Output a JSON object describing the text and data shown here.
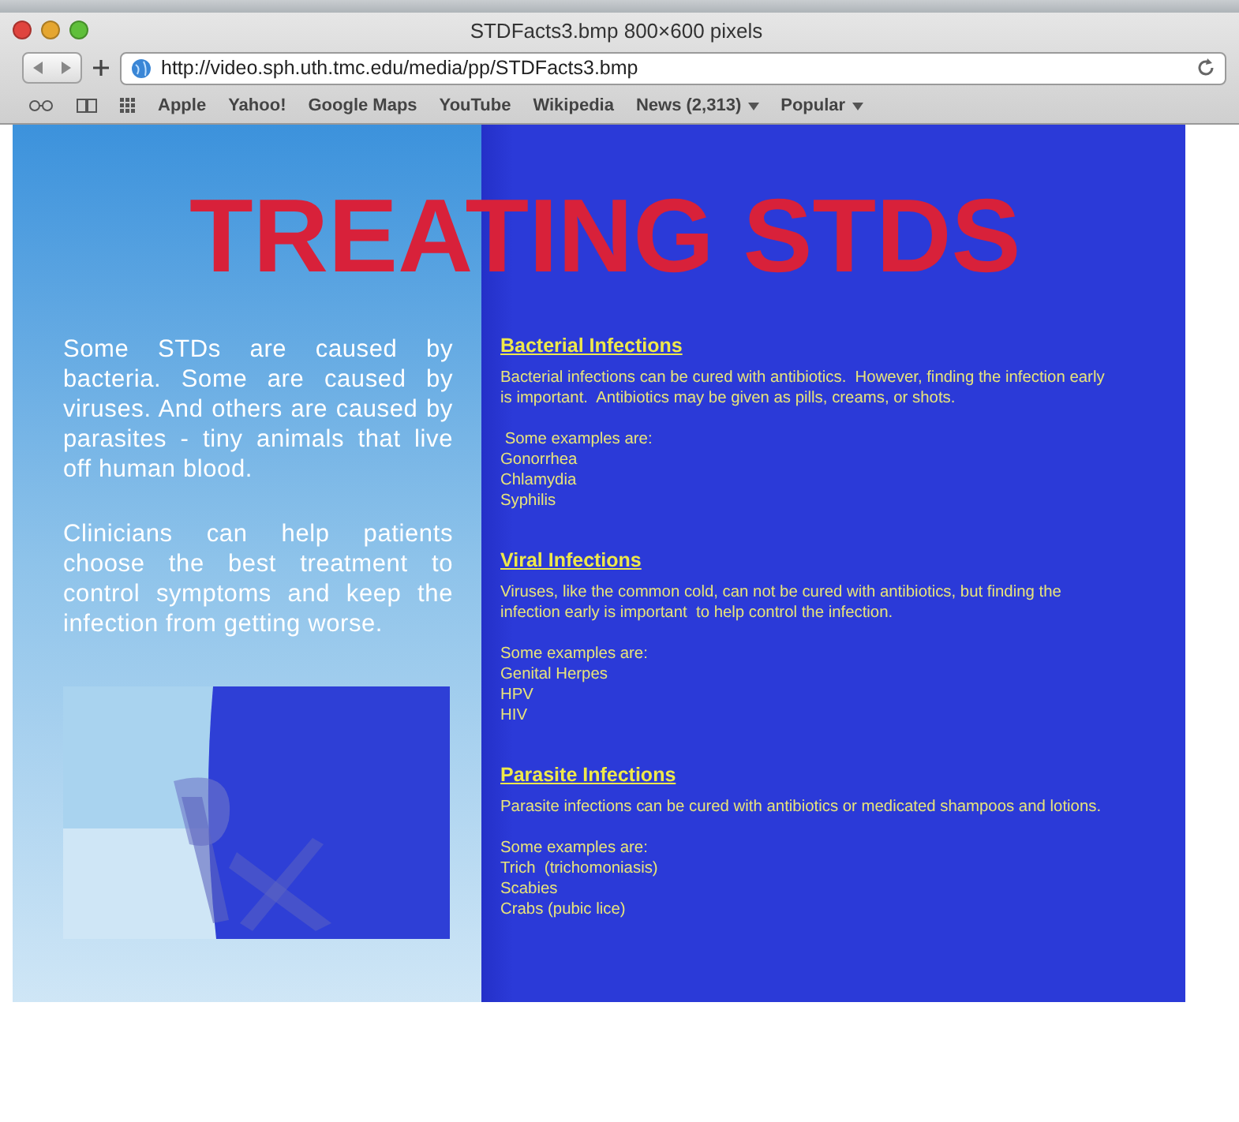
{
  "window": {
    "title": "STDFacts3.bmp 800×600 pixels"
  },
  "address_bar": {
    "value": "http://video.sph.uth.tmc.edu/media/pp/STDFacts3.bmp"
  },
  "bookmarks": [
    {
      "label": "Apple",
      "menu": false
    },
    {
      "label": "Yahoo!",
      "menu": false
    },
    {
      "label": "Google Maps",
      "menu": false
    },
    {
      "label": "YouTube",
      "menu": false
    },
    {
      "label": "Wikipedia",
      "menu": false
    },
    {
      "label": "News (2,313)",
      "menu": true
    },
    {
      "label": "Popular",
      "menu": true
    }
  ],
  "slide": {
    "title": "TREATING STDS",
    "intro": [
      "Some STDs are caused by bacteria. Some are caused by viruses.  And others are caused by parasites - tiny animals that live off human blood.",
      "Clinicians can help patients choose the best treatment to control symptoms and keep the infection from getting worse."
    ],
    "sections": [
      {
        "heading": "Bacterial Infections",
        "text": "Bacterial infections can be cured with antibiotics.  However, finding the infection early  is important.  Antibiotics may be given as pills, creams, or shots.",
        "examples_label": " Some examples are:",
        "examples": [
          "Gonorrhea",
          "Chlamydia",
          "Syphilis"
        ]
      },
      {
        "heading": "Viral Infections",
        "text": "Viruses, like the common cold, can not be cured with antibiotics, but finding the infection early is important  to help control the infection.",
        "examples_label": "Some examples are:",
        "examples": [
          "Genital Herpes",
          "HPV",
          "HIV"
        ]
      },
      {
        "heading": "Parasite Infections",
        "text": "Parasite infections can be cured with antibiotics or medicated shampoos and lotions.",
        "examples_label": "Some examples are:",
        "examples": [
          "Trich  (trichomoniasis)",
          "Scabies",
          "Crabs (pubic lice)"
        ]
      }
    ]
  }
}
